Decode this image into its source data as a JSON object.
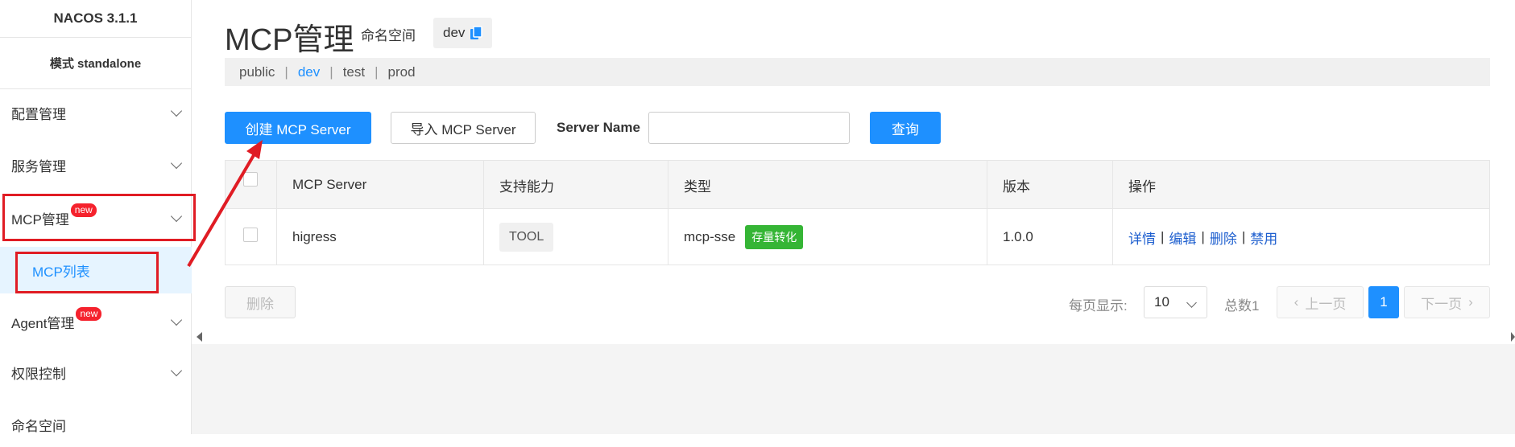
{
  "sidebar": {
    "brand": "NACOS 3.1.1",
    "mode": "模式 standalone",
    "items": [
      {
        "label": "配置管理"
      },
      {
        "label": "服务管理"
      },
      {
        "label": "MCP管理",
        "badge": "new"
      },
      {
        "label": "MCP列表"
      },
      {
        "label": "Agent管理",
        "badge": "new"
      },
      {
        "label": "权限控制"
      },
      {
        "label": "命名空间"
      }
    ]
  },
  "header": {
    "title": "MCP管理",
    "namespace_label": "命名空间",
    "namespace_value": "dev",
    "copy_icon": "copy-icon"
  },
  "namespaces": {
    "items": [
      "public",
      "dev",
      "test",
      "prod"
    ],
    "separator": "|",
    "active": "dev"
  },
  "toolbar": {
    "create_label": "创建 MCP Server",
    "import_label": "导入 MCP Server",
    "server_name_label": "Server Name",
    "server_name_value": "",
    "query_label": "查询"
  },
  "table": {
    "columns": [
      "MCP Server",
      "支持能力",
      "类型",
      "版本",
      "操作"
    ],
    "rows": [
      {
        "name": "higress",
        "capability": "TOOL",
        "type": "mcp-sse",
        "type_tag": "存量转化",
        "version": "1.0.0",
        "actions": [
          "详情",
          "编辑",
          "删除",
          "禁用"
        ],
        "action_separator": "|"
      }
    ]
  },
  "footer": {
    "delete_label": "删除",
    "page_size_label": "每页显示:",
    "page_size_value": "10",
    "total_label": "总数1",
    "prev_label": "上一页",
    "current_page": "1",
    "next_label": "下一页"
  },
  "colors": {
    "primary": "#1e90ff",
    "danger_badge": "#f5222d",
    "tag_green": "#35b535",
    "annotation_red": "#e01c24"
  }
}
